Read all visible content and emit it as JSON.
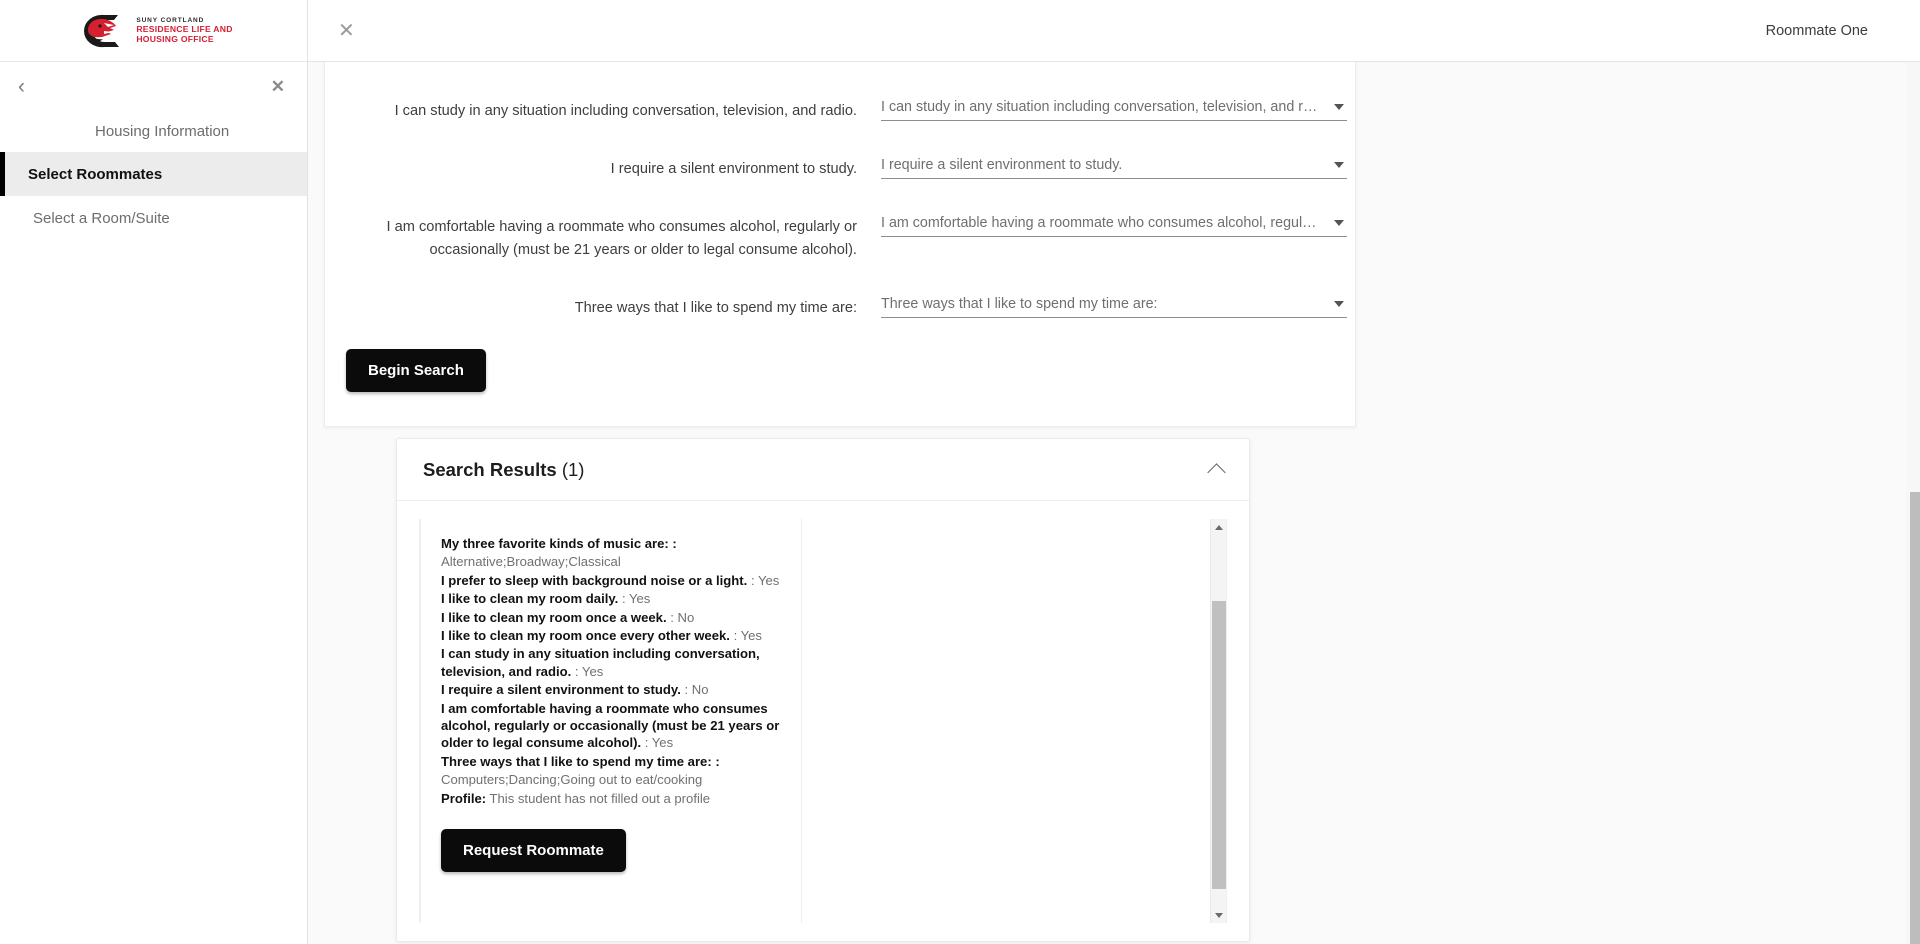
{
  "sidebar": {
    "logo": {
      "icon": "suny-cortland-dragon-logo",
      "line1": "SUNY CORTLAND",
      "line2": "RESIDENCE LIFE AND",
      "line3": "HOUSING OFFICE",
      "accent_color": "#d31f33"
    },
    "back_icon": "chevron-left-icon",
    "close_icon": "close-icon",
    "items": [
      {
        "label": "Housing Information",
        "active": false
      },
      {
        "label": "Select Roommates",
        "active": true
      },
      {
        "label": "Select a Room/Suite",
        "active": false
      }
    ]
  },
  "topbar": {
    "close_icon": "close-icon",
    "user": "Roommate One"
  },
  "form": {
    "questions": [
      {
        "label": "I can study in any situation including conversation, television, and radio.",
        "value": "I can study in any situation including conversation, television, and radio.",
        "caret_icon": "chevron-down-icon"
      },
      {
        "label": "I require a silent environment to study.",
        "value": "I require a silent environment to study.",
        "caret_icon": "chevron-down-icon"
      },
      {
        "label": "I am comfortable having a roommate who consumes alcohol, regularly or occasionally (must be 21 years or older to legal consume alcohol).",
        "value": "I am comfortable having a roommate who consumes alcohol, regularly o…",
        "caret_icon": "chevron-down-icon"
      },
      {
        "label": "Three ways that I like to spend my time are:",
        "value": "Three ways that I like to spend my time are:",
        "caret_icon": "chevron-down-icon"
      }
    ],
    "begin_search_label": "Begin Search"
  },
  "results": {
    "title_main": "Search Results",
    "title_count": "(1)",
    "collapse_icon": "chevron-up-icon",
    "scrollbar": {
      "up_icon": "triangle-up-icon",
      "down_icon": "triangle-down-icon"
    },
    "item": {
      "fields": [
        {
          "label": "My three favorite kinds of music are: :",
          "value": "Alternative;Broadway;Classical",
          "inline": false
        },
        {
          "label": "I prefer to sleep with background noise or a light.",
          "value": ": Yes",
          "inline": true
        },
        {
          "label": "I like to clean my room daily.",
          "value": ": Yes",
          "inline": true
        },
        {
          "label": "I like to clean my room once a week.",
          "value": ": No",
          "inline": true
        },
        {
          "label": "I like to clean my room once every other week.",
          "value": ": Yes",
          "inline": true
        },
        {
          "label": "I can study in any situation including conversation, television, and radio.",
          "value": ": Yes",
          "inline": true
        },
        {
          "label": "I require a silent environment to study.",
          "value": ": No",
          "inline": true
        },
        {
          "label": "I am comfortable having a roommate who consumes alcohol, regularly or occasionally (must be 21 years or older to legal consume alcohol).",
          "value": ": Yes",
          "inline": true
        },
        {
          "label": "Three ways that I like to spend my time are: :",
          "value": "Computers;Dancing;Going out to eat/cooking",
          "inline": false
        },
        {
          "label": "Profile:",
          "value": "This student has not filled out a profile",
          "inline": true
        }
      ],
      "request_label": "Request Roommate"
    }
  }
}
